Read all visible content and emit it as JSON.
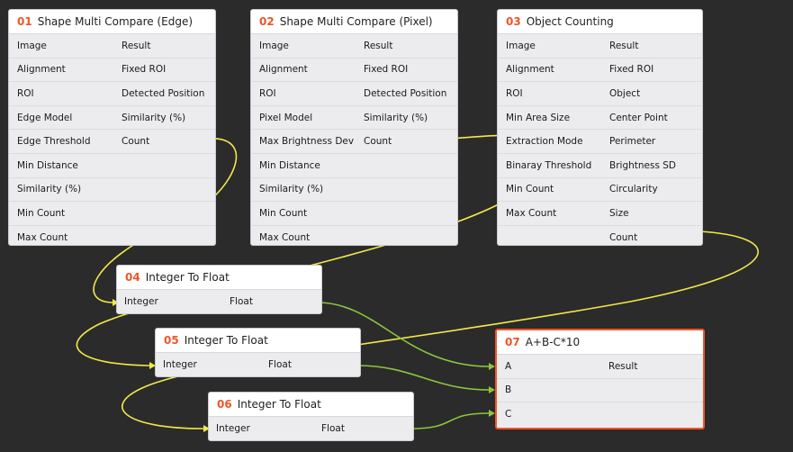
{
  "colors": {
    "background": "#2b2b2b",
    "node_bg": "#ececef",
    "header_bg": "#ffffff",
    "accent_number": "#f0552a",
    "selected_border": "#f0552a",
    "wire_yellow": "#f2e84a",
    "wire_green": "#8cc63f"
  },
  "nodes": {
    "n01": {
      "num": "01",
      "title": "Shape Multi Compare (Edge)",
      "inputs": [
        "Image",
        "Alignment",
        "ROI",
        "Edge Model",
        "Edge Threshold",
        "Min Distance",
        "Similarity (%)",
        "Min Count",
        "Max Count"
      ],
      "outputs": [
        "Result",
        "Fixed ROI",
        "Detected Position",
        "Similarity (%)",
        "Count"
      ]
    },
    "n02": {
      "num": "02",
      "title": "Shape Multi Compare (Pixel)",
      "inputs": [
        "Image",
        "Alignment",
        "ROI",
        "Pixel Model",
        "Max Brightness Dev",
        "Min Distance",
        "Similarity (%)",
        "Min Count",
        "Max Count"
      ],
      "outputs": [
        "Result",
        "Fixed ROI",
        "Detected Position",
        "Similarity (%)",
        "Count"
      ]
    },
    "n03": {
      "num": "03",
      "title": "Object Counting",
      "inputs": [
        "Image",
        "Alignment",
        "ROI",
        "Min Area Size",
        "Extraction Mode",
        "Binaray Threshold",
        "Min Count",
        "Max Count"
      ],
      "outputs": [
        "Result",
        "Fixed ROI",
        "Object",
        "Center Point",
        "Perimeter",
        "Brightness SD",
        "Circularity",
        "Size",
        "Count"
      ]
    },
    "n04": {
      "num": "04",
      "title": "Integer To Float",
      "input": "Integer",
      "output": "Float"
    },
    "n05": {
      "num": "05",
      "title": "Integer To Float",
      "input": "Integer",
      "output": "Float"
    },
    "n06": {
      "num": "06",
      "title": "Integer To Float",
      "input": "Integer",
      "output": "Float"
    },
    "n07": {
      "num": "07",
      "title": "A+B-C*10",
      "inputs": [
        "A",
        "B",
        "C"
      ],
      "output": "Result"
    }
  }
}
